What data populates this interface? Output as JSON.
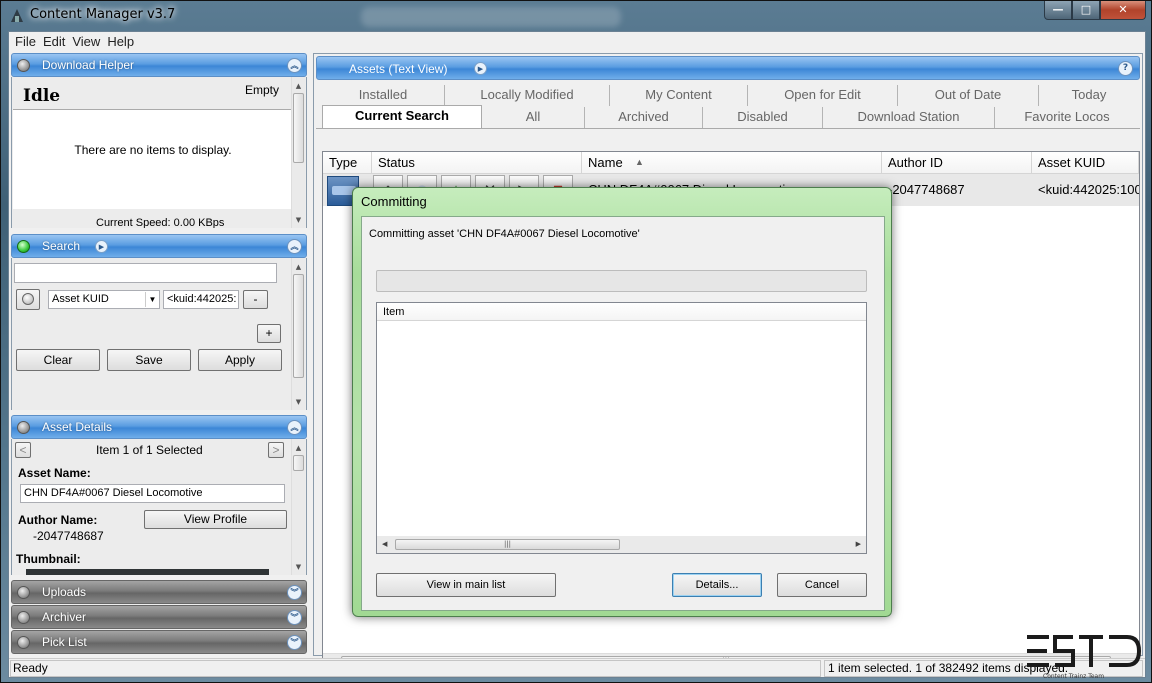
{
  "window": {
    "title": "Content Manager v3.7",
    "controls": {
      "minimize": "—",
      "maximize": "□",
      "close": "✕"
    }
  },
  "menu": [
    "File",
    "Edit",
    "View",
    "Help"
  ],
  "download_helper": {
    "header": "Download Helper",
    "status": "Idle",
    "state": "Empty",
    "empty_message": "There are no items to display.",
    "speed": "Current Speed: 0.00 KBps"
  },
  "search": {
    "header": "Search",
    "query_value": "",
    "field_select": "Asset KUID",
    "field_value": "<kuid:442025:",
    "remove_label": "-",
    "add_label": "+",
    "clear_label": "Clear",
    "save_label": "Save",
    "apply_label": "Apply"
  },
  "asset_details": {
    "header": "Asset Details",
    "nav_prev": "<",
    "nav_next": ">",
    "selection": "Item 1 of 1 Selected",
    "asset_name_label": "Asset Name:",
    "asset_name_value": "CHN DF4A#0067 Diesel Locomotive",
    "author_name_label": "Author Name:",
    "view_profile_label": "View Profile",
    "author_value": "-2047748687",
    "thumbnail_label": "Thumbnail:"
  },
  "collapsed_panels": [
    "Uploads",
    "Archiver",
    "Pick List"
  ],
  "assets_view": {
    "header": "Assets (Text View)",
    "help": "?",
    "tabs_back": [
      "Installed",
      "Locally Modified",
      "My Content",
      "Open for Edit",
      "Out of Date",
      "Today"
    ],
    "tabs_front": [
      "Current Search",
      "All",
      "Archived",
      "Disabled",
      "Download Station",
      "Favorite Locos"
    ],
    "active_tab": "Current Search",
    "columns": [
      "Type",
      "Status",
      "Name",
      "Author ID",
      "Asset KUID"
    ],
    "sort_indicator": "▲",
    "rows": [
      {
        "name": "CHN DF4A#0067 Diesel Locomotive",
        "author_id": "-2047748687",
        "kuid": "<kuid:442025:100"
      }
    ],
    "status_icons": [
      "stamp-icon",
      "disc-icon",
      "triangle-icon",
      "tools-icon",
      "folder-icon",
      "paint-icon"
    ]
  },
  "dialog": {
    "title": "Committing",
    "message": "Committing asset 'CHN DF4A#0067 Diesel Locomotive'",
    "list_header": "Item",
    "progress": 0,
    "view_in_list_label": "View in main list",
    "details_label": "Details...",
    "cancel_label": "Cancel"
  },
  "statusbar": {
    "left": "Ready",
    "right": "1 item selected. 1 of 382492 items displayed."
  },
  "watermark": {
    "logo_text": "ESTD",
    "caption": "Content Trainz Team"
  },
  "colors": {
    "panel_blue": "#5a9de1",
    "dialog_green": "#a7dc9a",
    "row_highlight": "#e8e8e8"
  }
}
